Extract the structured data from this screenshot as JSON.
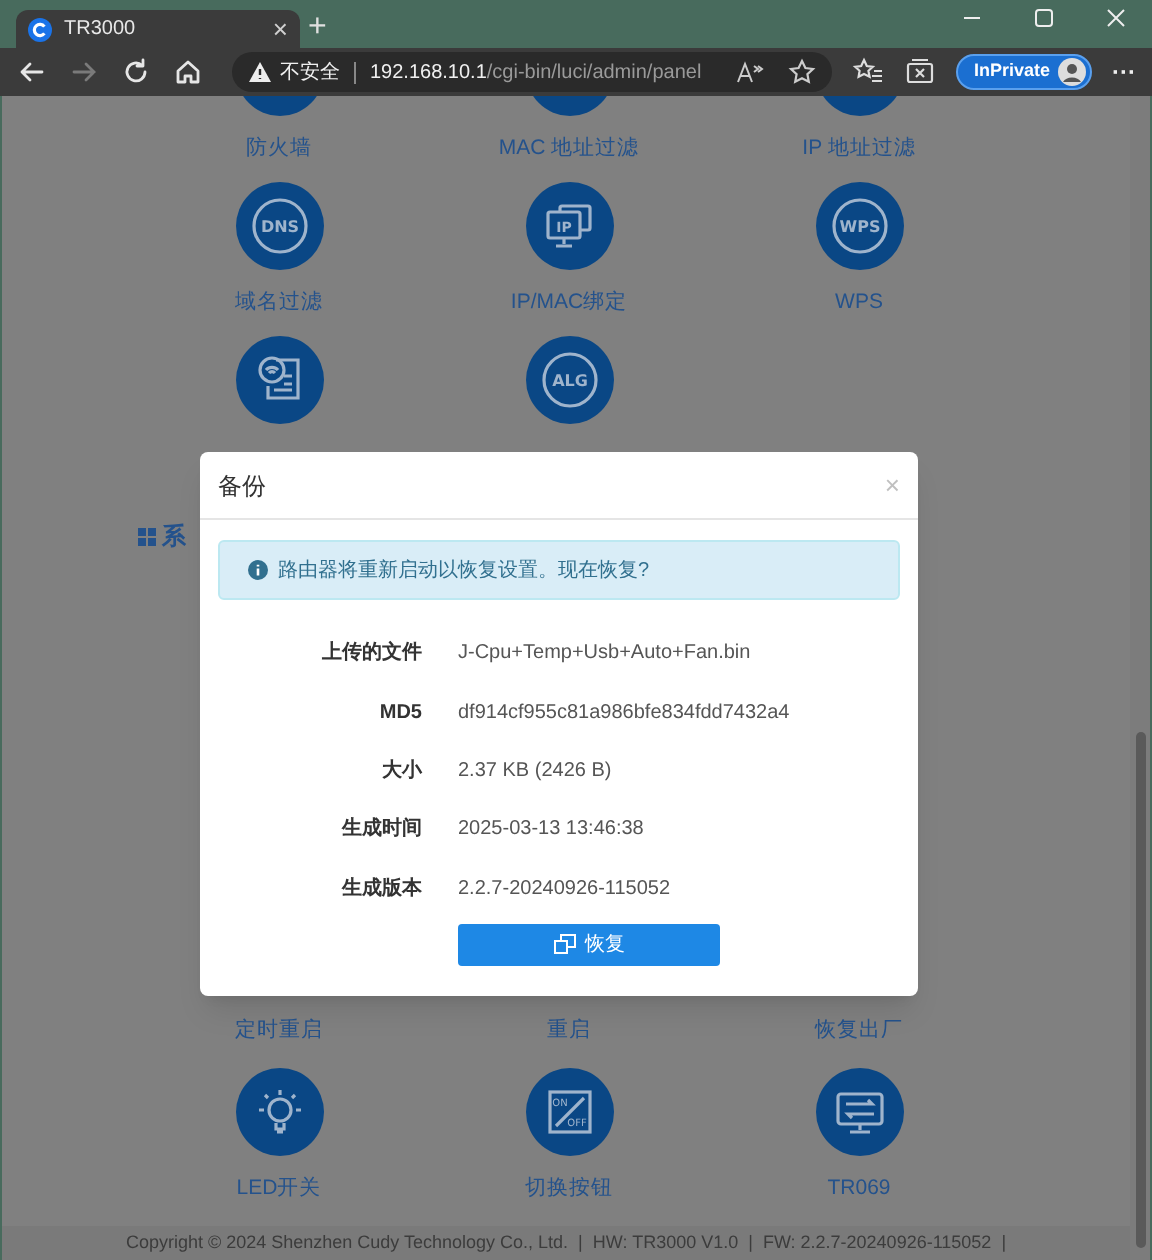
{
  "browser": {
    "tab_title": "TR3000",
    "tab_close": "×",
    "new_tab": "+",
    "security": "不安全",
    "url_host": "192.168.10.1",
    "url_path": "/cgi-bin/luci/admin/panel",
    "profile": "InPrivate",
    "more": "···"
  },
  "page": {
    "rows": [
      [
        {
          "label": "防火墙"
        },
        {
          "label": "MAC 地址过滤"
        },
        {
          "label": "IP 地址过滤"
        }
      ],
      [
        {
          "label": "域名过滤",
          "icon": {
            "kind": "badge",
            "text": "DNS"
          }
        },
        {
          "label": "IP/MAC绑定",
          "icon": {
            "kind": "screens",
            "text": "IP"
          }
        },
        {
          "label": "WPS",
          "icon": {
            "kind": "badge",
            "text": "WPS"
          }
        }
      ],
      [
        {
          "icon": {
            "kind": "wifi-doc"
          }
        },
        {
          "icon": {
            "kind": "badge",
            "text": "ALG"
          }
        }
      ]
    ],
    "section_header": "系",
    "hidden_row_labels": [
      "定时重启",
      "重启",
      "恢复出厂"
    ],
    "bottom_row": [
      {
        "label": "LED开关",
        "icon": {
          "kind": "bulb"
        }
      },
      {
        "label": "切换按钮",
        "icon": {
          "kind": "switch",
          "texts": [
            "ON",
            "OFF"
          ]
        }
      },
      {
        "label": "TR069",
        "icon": {
          "kind": "monitor"
        }
      }
    ],
    "footer": "Copyright © 2024 Shenzhen Cudy Technology Co., Ltd.  |  HW: TR3000 V1.0  |  FW: 2.2.7-20240926-115052  |"
  },
  "dialog": {
    "title": "备份",
    "close": "×",
    "alert": "路由器将重新启动以恢复设置。现在恢复?",
    "fields": [
      {
        "label": "上传的文件",
        "value": "J-Cpu+Temp+Usb+Auto+Fan.bin"
      },
      {
        "label": "MD5",
        "value": "df914cf955c81a986bfe834fdd7432a4"
      },
      {
        "label": "大小",
        "value": "2.37 KB (2426 B)"
      },
      {
        "label": "生成时间",
        "value": "2025-03-13 13:46:38"
      },
      {
        "label": "生成版本",
        "value": "2.2.7-20240926-115052"
      }
    ],
    "button": "恢复"
  }
}
